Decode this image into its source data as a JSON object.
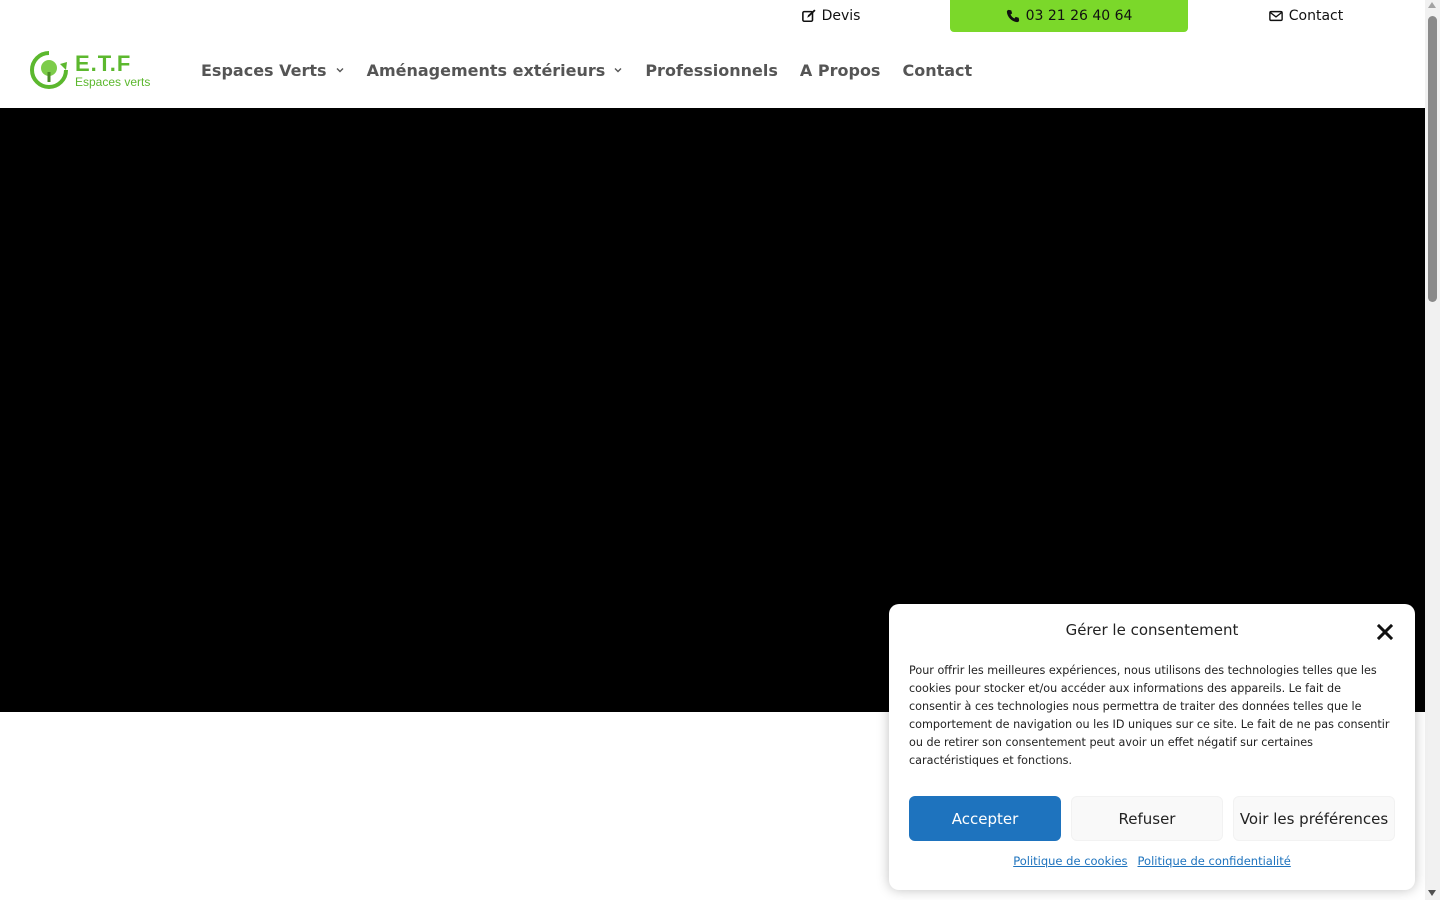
{
  "topbar": {
    "devis_label": "Devis",
    "phone_label": "03 21 26 40 64",
    "contact_label": "Contact",
    "accent_color": "#7bd82a"
  },
  "logo": {
    "title": "E.T.F",
    "subtitle": "Espaces verts"
  },
  "nav": {
    "items": [
      {
        "label": "Espaces Verts",
        "has_dropdown": true
      },
      {
        "label": "Aménagements extérieurs",
        "has_dropdown": true
      },
      {
        "label": "Professionnels",
        "has_dropdown": false
      },
      {
        "label": "A Propos",
        "has_dropdown": false
      },
      {
        "label": "Contact",
        "has_dropdown": false
      }
    ]
  },
  "consent": {
    "title": "Gérer le consentement",
    "text": "Pour offrir les meilleures expériences, nous utilisons des technologies telles que les cookies pour stocker et/ou accéder aux informations des appareils. Le fait de consentir à ces technologies nous permettra de traiter des données telles que le comportement de navigation ou les ID uniques sur ce site. Le fait de ne pas consentir ou de retirer son consentement peut avoir un effet négatif sur certaines caractéristiques et fonctions.",
    "accept_label": "Accepter",
    "refuse_label": "Refuser",
    "prefs_label": "Voir les préférences",
    "cookie_policy_label": "Politique de cookies",
    "privacy_policy_label": "Politique de confidentialité",
    "accept_color": "#1e73be"
  },
  "icons": {
    "devis": "edit-icon",
    "phone": "phone-icon",
    "contact": "envelope-icon",
    "close": "close-icon",
    "dropdown": "chevron-down-icon"
  }
}
